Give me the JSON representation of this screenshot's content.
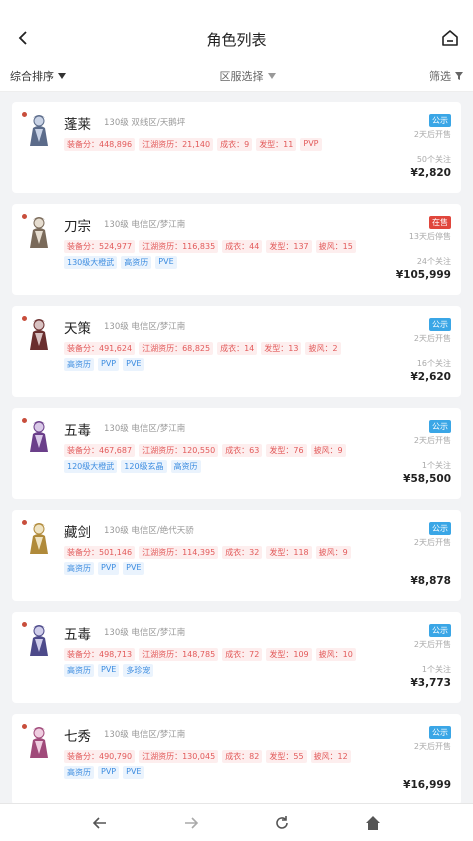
{
  "header": {
    "title": "角色列表"
  },
  "filters": {
    "sort": "综合排序",
    "server": "区服选择",
    "filter": "筛选"
  },
  "cards": [
    {
      "name": "蓬莱",
      "meta": "130级  双线区/天鹅坪",
      "stats": [
        "装备分：448,896",
        "江湖资历：21,140",
        "成衣：9",
        "发型：11",
        "PVP"
      ],
      "tags": [],
      "badge": "公示",
      "badge_type": "pub",
      "when": "2天后开售",
      "follow": "50个关注",
      "price": "¥2,820"
    },
    {
      "name": "刀宗",
      "meta": "130级  电信区/梦江南",
      "stats": [
        "装备分：524,977",
        "江湖资历：116,835",
        "成衣：44",
        "发型：137",
        "披风：15"
      ],
      "tags": [
        "130级大橙武",
        "高资历",
        "PVE"
      ],
      "badge": "在售",
      "badge_type": "sell",
      "when": "13天后停售",
      "follow": "24个关注",
      "price": "¥105,999"
    },
    {
      "name": "天策",
      "meta": "130级  电信区/梦江南",
      "stats": [
        "装备分：491,624",
        "江湖资历：68,825",
        "成衣：14",
        "发型：13",
        "披风：2"
      ],
      "tags": [
        "高资历",
        "PVP",
        "PVE"
      ],
      "badge": "公示",
      "badge_type": "pub",
      "when": "2天后开售",
      "follow": "16个关注",
      "price": "¥2,620"
    },
    {
      "name": "五毒",
      "meta": "130级  电信区/梦江南",
      "stats": [
        "装备分：467,687",
        "江湖资历：120,550",
        "成衣：63",
        "发型：76",
        "披风：9"
      ],
      "tags": [
        "120级大橙武",
        "120级玄晶",
        "高资历"
      ],
      "badge": "公示",
      "badge_type": "pub",
      "when": "2天后开售",
      "follow": "1个关注",
      "price": "¥58,500"
    },
    {
      "name": "藏剑",
      "meta": "130级  电信区/绝代天骄",
      "stats": [
        "装备分：501,146",
        "江湖资历：114,395",
        "成衣：32",
        "发型：118",
        "披风：9"
      ],
      "tags": [
        "高资历",
        "PVP",
        "PVE"
      ],
      "badge": "公示",
      "badge_type": "pub",
      "when": "2天后开售",
      "follow": "",
      "price": "¥8,878"
    },
    {
      "name": "五毒",
      "meta": "130级  电信区/梦江南",
      "stats": [
        "装备分：498,713",
        "江湖资历：148,785",
        "成衣：72",
        "发型：109",
        "披风：10"
      ],
      "tags": [
        "高资历",
        "PVE",
        "多珍宠"
      ],
      "badge": "公示",
      "badge_type": "pub",
      "when": "2天后开售",
      "follow": "1个关注",
      "price": "¥3,773"
    },
    {
      "name": "七秀",
      "meta": "130级  电信区/梦江南",
      "stats": [
        "装备分：490,790",
        "江湖资历：130,045",
        "成衣：82",
        "发型：55",
        "披风：12"
      ],
      "tags": [
        "高资历",
        "PVP",
        "PVE"
      ],
      "badge": "公示",
      "badge_type": "pub",
      "when": "2天后开售",
      "follow": "",
      "price": "¥16,999"
    }
  ],
  "colors": {
    "price_red": "#e25a5a",
    "tag_blue": "#3c8ce0",
    "badge_pub": "#3aa6e6",
    "badge_sell": "#e0463c"
  },
  "icons": {
    "back": "chevron-left-icon",
    "home": "home-icon",
    "nav": [
      "arrow-left-icon",
      "arrow-right-icon",
      "refresh-icon",
      "home-icon"
    ]
  }
}
